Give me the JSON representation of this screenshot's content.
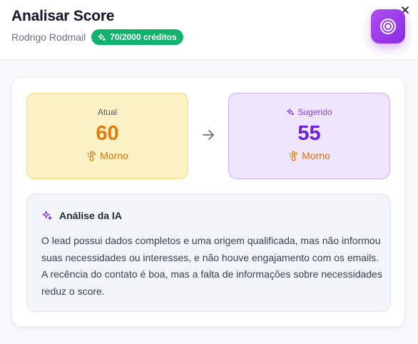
{
  "header": {
    "title": "Analisar Score",
    "user_name": "Rodrigo Rodmail",
    "credits": "70/2000 créditos"
  },
  "scores": {
    "current": {
      "label": "Atual",
      "value": "60",
      "temperature": "Morno"
    },
    "suggested": {
      "label": "Sugerido",
      "value": "55",
      "temperature": "Morno"
    }
  },
  "analysis": {
    "title": "Análise da IA",
    "text": "O lead possui dados completos e uma origem qualificada, mas não informou suas necessidades ou interesses, e não houve engajamento com os emails. A recência do contato é boa, mas a falta de informações sobre necessidades reduz o score."
  },
  "icons": {
    "close": "close-icon",
    "target": "target-icon",
    "sparkles": "sparkles-icon",
    "thermometer": "thermometer-icon",
    "arrow": "arrow-right-icon"
  },
  "colors": {
    "credits_badge": "#10b26c",
    "current_bg": "#fdf2c5",
    "current_value": "#e07b0c",
    "suggested_bg": "#efe6fd",
    "suggested_value": "#6d1fe0",
    "target_button": "#9b3cec"
  }
}
